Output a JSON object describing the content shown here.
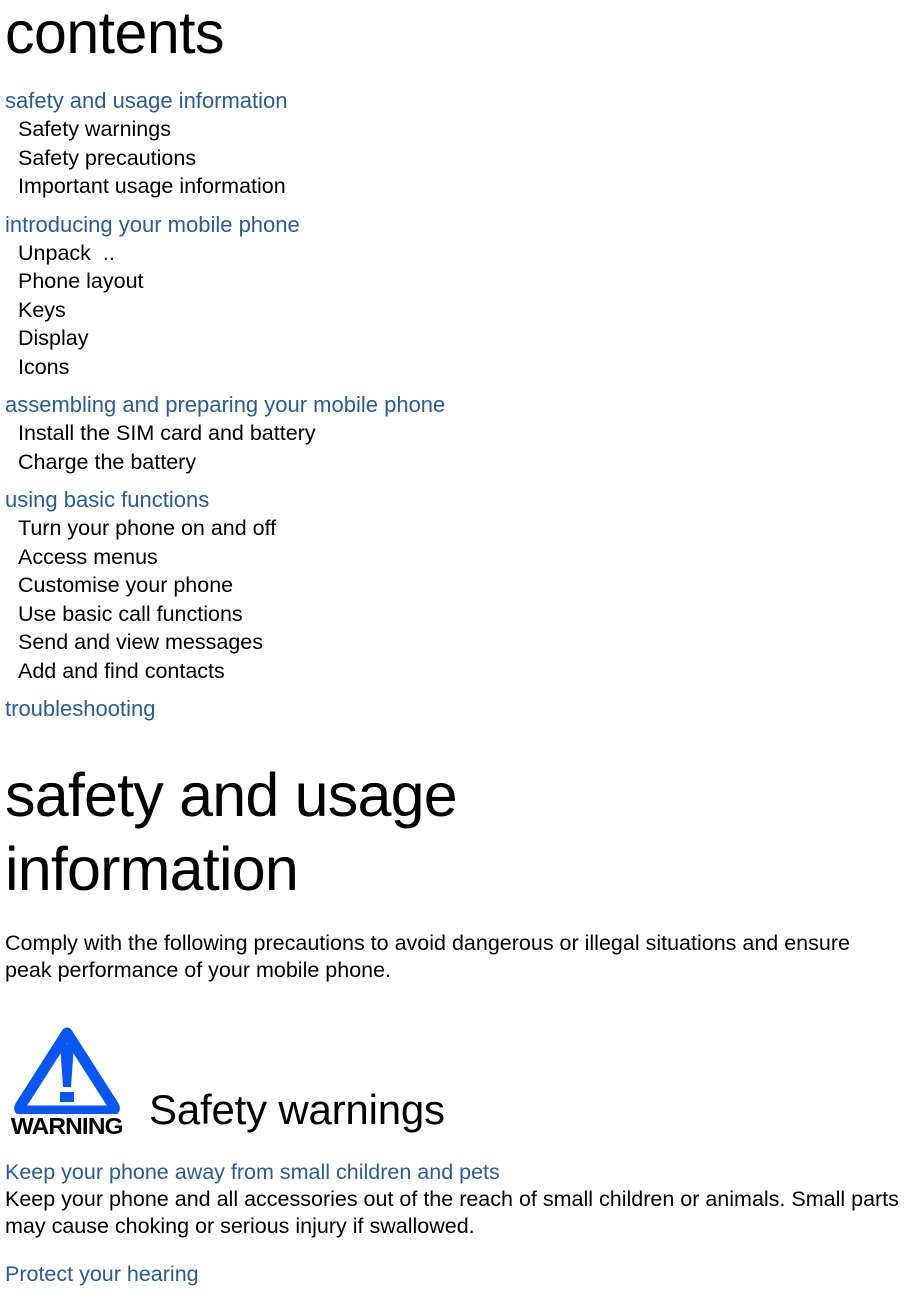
{
  "page": {
    "title": "contents",
    "accent_blue": "#2E5A8E",
    "warning_icon_blue": "#0A56F5",
    "text_black": "#000000"
  },
  "toc": {
    "groups": [
      {
        "section": "safety and usage information",
        "items": [
          "Safety warnings",
          "Safety precautions",
          "Important usage information"
        ]
      },
      {
        "section": "introducing your mobile phone",
        "items": [
          "Unpack  ..",
          "Phone layout",
          "Keys",
          "Display",
          "Icons"
        ]
      },
      {
        "section": "assembling and preparing your mobile phone",
        "items": [
          "Install the SIM card and battery",
          "Charge the battery"
        ]
      },
      {
        "section": "using basic functions",
        "items": [
          "Turn your phone on and off",
          "Access menus",
          "Customise your phone",
          "Use basic call functions",
          "Send and view messages",
          "Add and find contacts"
        ]
      },
      {
        "section": "troubleshooting",
        "items": []
      }
    ]
  },
  "chapter": {
    "title_line1": "safety and usage",
    "title_line2": "information",
    "intro": "Comply with the following precautions to avoid dangerous or illegal situations and ensure peak performance of your mobile phone."
  },
  "warning_section": {
    "icon_name": "warning-triangle-icon",
    "icon_label": "WARNING",
    "heading": "Safety warnings",
    "subsections": [
      {
        "title": "Keep your phone away from small children and pets",
        "body": "Keep your phone and all accessories out of the reach of small children or animals. Small parts may cause choking or serious injury if swallowed."
      },
      {
        "title": "Protect your hearing",
        "body": ""
      }
    ]
  }
}
